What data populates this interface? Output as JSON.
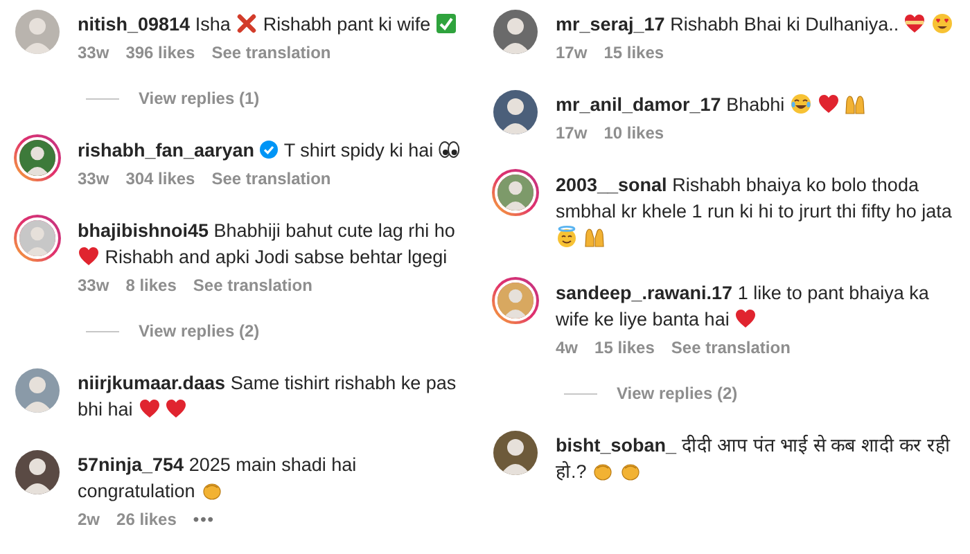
{
  "columns": [
    {
      "comments": [
        {
          "username": "nitish_09814",
          "story_ring": false,
          "verified": false,
          "message": [
            {
              "kind": "text",
              "text": "Isha"
            },
            {
              "kind": "cross"
            },
            {
              "kind": "text",
              "text": "Rishabh pant ki wife"
            },
            {
              "kind": "check"
            }
          ],
          "time": "33w",
          "likes": "396 likes",
          "translation": "See translation",
          "replies": "View replies (1)"
        },
        {
          "username": "rishabh_fan_aaryan",
          "story_ring": true,
          "verified": true,
          "message": [
            {
              "kind": "text",
              "text": "T shirt spidy ki hai"
            },
            {
              "kind": "eyes"
            }
          ],
          "time": "33w",
          "likes": "304 likes",
          "translation": "See translation"
        },
        {
          "username": "bhajibishnoi45",
          "story_ring": true,
          "verified": false,
          "message": [
            {
              "kind": "text",
              "text": "Bhabhiji bahut cute lag rhi ho"
            },
            {
              "kind": "heart"
            },
            {
              "kind": "text",
              "text": "Rishabh and apki Jodi sabse behtar lgegi"
            }
          ],
          "time": "33w",
          "likes": "8 likes",
          "translation": "See translation",
          "replies": "View replies (2)"
        },
        {
          "username": "niirjkumaar.daas",
          "story_ring": false,
          "verified": false,
          "message": [
            {
              "kind": "text",
              "text": "Same tishirt rishabh ke pas bhi hai"
            },
            {
              "kind": "heart"
            },
            {
              "kind": "heart"
            }
          ]
        },
        {
          "username": "57ninja_754",
          "story_ring": false,
          "verified": false,
          "message": [
            {
              "kind": "text",
              "text": "2025 main shadi hai congratulation"
            },
            {
              "kind": "clap"
            }
          ],
          "time": "2w",
          "likes": "26 likes",
          "more": "•••"
        }
      ]
    },
    {
      "comments": [
        {
          "username": "mr_seraj_17",
          "story_ring": false,
          "verified": false,
          "message": [
            {
              "kind": "text",
              "text": "Rishabh Bhai ki Dulhaniya.."
            },
            {
              "kind": "heart_band"
            },
            {
              "kind": "heart_eyes"
            }
          ],
          "time": "17w",
          "likes": "15 likes"
        },
        {
          "username": "mr_anil_damor_17",
          "story_ring": false,
          "verified": false,
          "message": [
            {
              "kind": "text",
              "text": "Bhabhi"
            },
            {
              "kind": "joy"
            },
            {
              "kind": "heart"
            },
            {
              "kind": "raised_hands"
            }
          ],
          "time": "17w",
          "likes": "10 likes"
        },
        {
          "username": "2003__sonal",
          "story_ring": true,
          "verified": false,
          "message": [
            {
              "kind": "text",
              "text": "Rishabh bhaiya ko bolo thoda smbhal kr khele 1 run ki hi to jrurt thi fifty ho jata"
            },
            {
              "kind": "halo"
            },
            {
              "kind": "raised_hands"
            }
          ]
        },
        {
          "username": "sandeep_.rawani.17",
          "story_ring": true,
          "verified": false,
          "message": [
            {
              "kind": "text",
              "text": "1 like to pant bhaiya ka wife ke liye banta hai"
            },
            {
              "kind": "heart"
            }
          ],
          "time": "4w",
          "likes": "15 likes",
          "translation": "See translation",
          "replies": "View replies (2)"
        },
        {
          "username": "bisht_soban_",
          "story_ring": false,
          "verified": false,
          "message": [
            {
              "kind": "text",
              "text": "दीदी आप पंत भाई से कब शादी कर रही हो.?"
            },
            {
              "kind": "clap"
            },
            {
              "kind": "clap"
            }
          ]
        }
      ]
    }
  ]
}
